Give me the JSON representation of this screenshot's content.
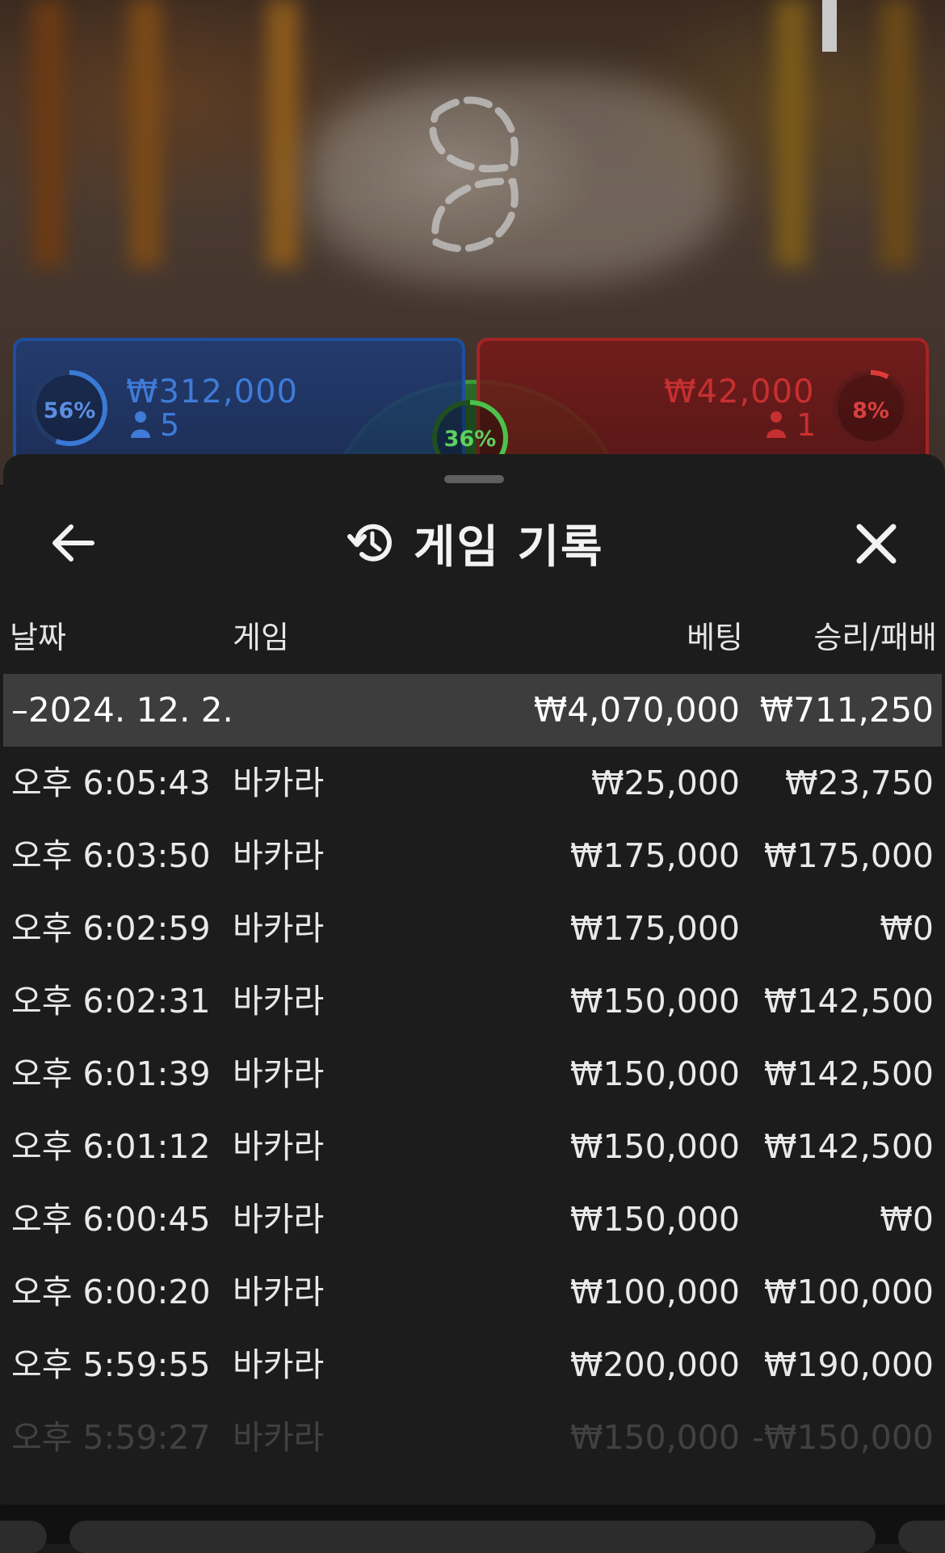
{
  "game": {
    "player": {
      "percent": "56%",
      "percent_value": 0.56,
      "amount": "₩312,000",
      "count": "5",
      "color": "#1e4f9e"
    },
    "tie": {
      "percent": "36%",
      "percent_value": 0.36,
      "color": "#3a9a3a"
    },
    "banker": {
      "percent": "8%",
      "percent_value": 0.08,
      "amount": "₩42,000",
      "count": "1",
      "color": "#a32424"
    }
  },
  "sheet": {
    "title": "게임 기록",
    "icons": {
      "back": "arrow-left-icon",
      "history": "history-clock-icon",
      "close": "close-icon"
    },
    "columns": {
      "date": "날짜",
      "game": "게임",
      "bet": "베팅",
      "result": "승리/패배"
    },
    "date_group": {
      "label": "–2024. 12. 2.",
      "bet": "₩4,070,000",
      "result": "₩711,250"
    },
    "rows": [
      {
        "time": "오후 6:05:43",
        "game": "바카라",
        "bet": "₩25,000",
        "result": "₩23,750"
      },
      {
        "time": "오후 6:03:50",
        "game": "바카라",
        "bet": "₩175,000",
        "result": "₩175,000"
      },
      {
        "time": "오후 6:02:59",
        "game": "바카라",
        "bet": "₩175,000",
        "result": "₩0"
      },
      {
        "time": "오후 6:02:31",
        "game": "바카라",
        "bet": "₩150,000",
        "result": "₩142,500"
      },
      {
        "time": "오후 6:01:39",
        "game": "바카라",
        "bet": "₩150,000",
        "result": "₩142,500"
      },
      {
        "time": "오후 6:01:12",
        "game": "바카라",
        "bet": "₩150,000",
        "result": "₩142,500"
      },
      {
        "time": "오후 6:00:45",
        "game": "바카라",
        "bet": "₩150,000",
        "result": "₩0"
      },
      {
        "time": "오후 6:00:20",
        "game": "바카라",
        "bet": "₩100,000",
        "result": "₩100,000"
      },
      {
        "time": "오후 5:59:55",
        "game": "바카라",
        "bet": "₩200,000",
        "result": "₩190,000"
      },
      {
        "time": "오후 5:59:27",
        "game": "바카라",
        "bet": "₩150,000",
        "result": "-₩150,000"
      }
    ]
  }
}
